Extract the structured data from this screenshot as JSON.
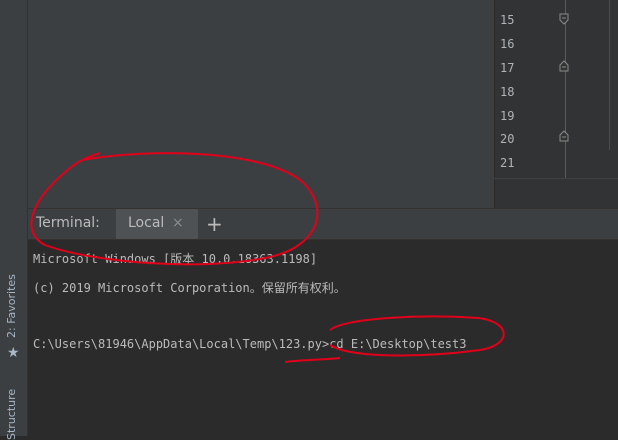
{
  "sidebar": {
    "favorites_label": "2: Favorites",
    "structure_label": "Structure"
  },
  "editor": {
    "line_numbers": [
      "15",
      "16",
      "17",
      "18",
      "19",
      "20",
      "21"
    ]
  },
  "terminal": {
    "title": "Terminal:",
    "tabs": [
      {
        "label": "Local",
        "close": "×"
      }
    ],
    "add_tab": "+",
    "lines": [
      "Microsoft Windows [版本 10.0.18363.1198]",
      "(c) 2019 Microsoft Corporation。保留所有权利。",
      "",
      "C:\\Users\\81946\\AppData\\Local\\Temp\\123.py>cd E:\\Desktop\\test3"
    ]
  },
  "colors": {
    "annotation": "#e0001a",
    "background": "#2b2b2b",
    "panel": "#3c3f41"
  },
  "icons": [
    "star-icon",
    "fold-icon",
    "close-icon",
    "add-icon"
  ]
}
